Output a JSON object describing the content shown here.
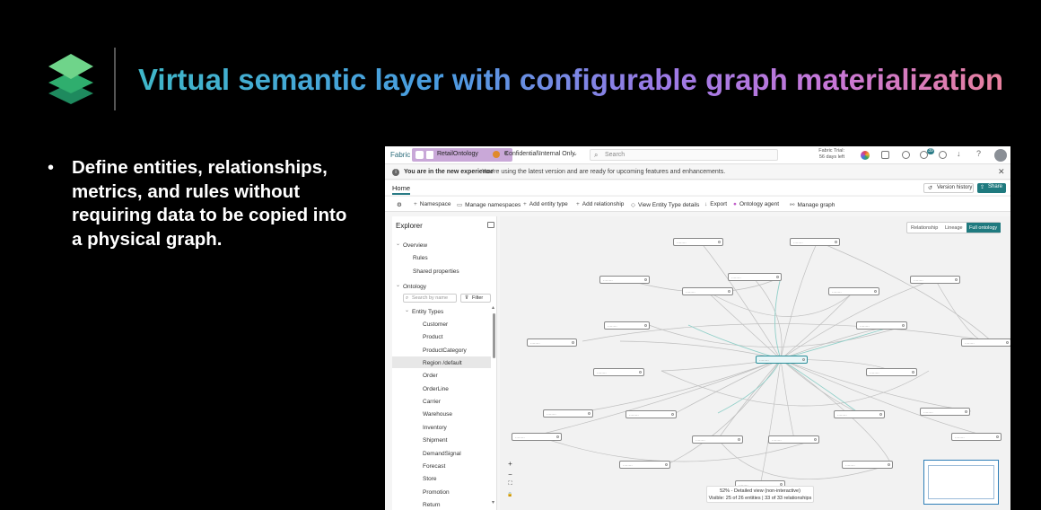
{
  "slide": {
    "title": "Virtual semantic layer with configurable graph materialization",
    "bullet": "Define entities, relationships, metrics, and rules without requiring data to be copied into a physical graph."
  },
  "app": {
    "brand": "Fabric",
    "active_tab": "RetailOntology",
    "sensitivity": "Confidential\\Internal Only",
    "search_placeholder": "Search",
    "trial_line1": "Fabric Trial:",
    "trial_line2": "56 days left",
    "notification_count": "39",
    "info_bold": "You are in the new experience",
    "info_message": "You're using the latest version and are ready for upcoming features and enhancements.",
    "home_tab": "Home",
    "version_history": "Version history",
    "share": "Share",
    "toolbar": [
      "Namespace",
      "Manage namespaces",
      "Add entity type",
      "Add relationship",
      "View Entity Type details",
      "Export",
      "Ontology agent",
      "Manage graph"
    ],
    "explorer": {
      "title": "Explorer",
      "overview": "Overview",
      "rules": "Rules",
      "shared_properties": "Shared properties",
      "ontology": "Ontology",
      "search_placeholder": "Search by name",
      "filter": "Filter",
      "entity_types_label": "Entity Types",
      "entity_types": [
        "Customer",
        "Product",
        "ProductCategory",
        "Region /default",
        "Order",
        "OrderLine",
        "Carrier",
        "Warehouse",
        "Inventory",
        "Shipment",
        "DemandSignal",
        "Forecast",
        "Store",
        "Promotion",
        "Return"
      ],
      "selected": "Region /default"
    },
    "view_toggle": [
      "Relationship",
      "Lineage",
      "Full ontology"
    ],
    "view_active": "Full ontology",
    "status_line1": "52% - Detailed view (non-interactive)",
    "status_line2": "Visible: 25 of 26 entities | 33 of 33 relationships",
    "zoom_controls": [
      "+",
      "−",
      "⛶",
      "🔒"
    ]
  }
}
